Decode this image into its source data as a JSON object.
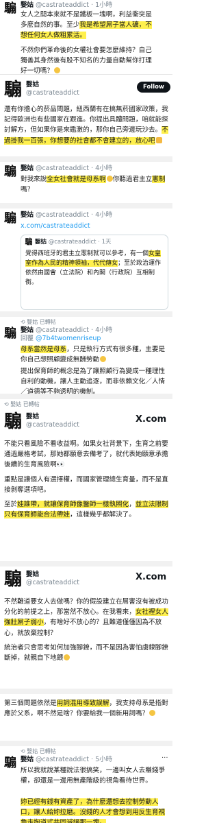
{
  "post1": {
    "text_lines": [
      "女人之間本來就不是鐵板一塊啊，利益衝突是",
      "多麼自然的事。至少我是希望屌子當人礦，不",
      "想任何女人做粗累活。",
      "不然你們革命後的女權社會要怎麼維持？自己",
      "獨善其身然後有股不知名的力量自動幫你打理",
      "好一切嗎？"
    ],
    "time_fragment": "小時",
    "hl": "我是希望屌子當人礦，不想任何女人做粗累活。"
  },
  "tweet2": {
    "name": "嫛姑",
    "handle": "@castrateaddict",
    "follow_label": "Follow",
    "avatar_char": "騸",
    "text_prefix": "還有你擔心的菸品問題，紐西蘭有在搞無菸國家政策，我記得歐洲也有些國家在跟進。你提出具體問題，咱就能探討解方，但如果你是來鑑激的，那你自己旁邊玩沙去。",
    "text_hl": "不過掛我一百張，你想要的社會都不會建立的，放心吧",
    "emoji_label": "👍"
  },
  "tweet3": {
    "name": "嫛姑",
    "handle": "@castrateaddict",
    "time": "4小時",
    "avatar_char": "騸",
    "text_a": "對我來說",
    "text_hl1": "全女社會就是母系啊",
    "text_b": "你聽過君主立",
    "text_hl2": "憲制",
    "text_c": "嗎？",
    "emoji_label": "🤔"
  },
  "tweet4": {
    "name": "嫛姑",
    "handle": "@castrateaddict",
    "time": "4小時",
    "avatar_char": "騸",
    "link": "x.com/castrateaddict",
    "quote": {
      "name": "嫛姑",
      "handle": "@castrateaddict",
      "time": "1天",
      "avatar_char": "騸",
      "text_a": "覺得西班牙的君主立憲制就可以參考，有一個",
      "text_hl": "女皇室作為人民的精神領袖，代代傳女",
      "text_b": "；至於政治運作依然由國會（立法院）和內閣（行政院）互相制衡。"
    }
  },
  "tweet5": {
    "retweet_label": "嫛姑 已轉帖",
    "name": "嫛姑",
    "handle": "@castrateaddict",
    "time": "4小時",
    "reply_to": "@7b4twomenriseup",
    "avatar_char": "騸",
    "text_hl": "母系當然是母系",
    "text_a": "，只是執行方式有很多種，主要是你自己想照顧變成無酬勞動",
    "text_p2": "提出保育師的概念是為了讓照顧行為變成一種理性自利的動機，讓人主動追逐，而非依賴文化／人情／道德等不夠透明的機制。",
    "emoji_label": "🤔"
  },
  "tweet6": {
    "retweet_label": "嫛姑 已轉帖",
    "name": "嫛姑",
    "handle": "@castrateaddict",
    "avatar_char": "騸",
    "brand": "X.com",
    "p1": "不能只看風險不看收益啊。如果女社背景下，生育之前要通過嚴格考試，那她都願意去備考了，就代表她願意承擔後續的生育風險啊",
    "p2": "重點是讓個人有選擇權，而國家管理總生育量，而不是直接剝奪選項吧。",
    "p3_a": "至於",
    "p3_hl1": "娃誰帶",
    "p3_b": "，就讓保育師像醫師一樣執照化",
    "p3_c": "，",
    "p3_hl2": "並立法限制只有保育師能合法帶娃",
    "p3_d": "，這樣幾乎都解決了。"
  },
  "tweet7": {
    "name": "嫛姑",
    "handle": "@castrateaddict",
    "avatar_char": "騸",
    "brand": "X.com",
    "p1_a": "不然難道要女人去做嗎？你的假設建立在屌害沒有被成功分化的前提之上，那當然不放心。在我看來，",
    "p1_hl": "女社裡女人強壯屌子弱小",
    "p1_b": "，有啥好不放心的？且難道僅僅因為不放心，就放棄控制？",
    "p2": "統治者只會思考如何加強腳鐐，而不是因為害怕虜隸腳鐐斷掉，就親自下地餵",
    "emoji_label": "😂"
  },
  "tweet8": {
    "p1_a": "第三個問題依然是",
    "p1_hl": "用詞混用導致誤解",
    "p1_b": "，我支持母系是指對應於父系，啊不然是啥？你要給我一個新用詞嗎？",
    "emoji_label": "🤔"
  },
  "tweet9": {
    "retweet_label": "嫛姑 已轉帖",
    "name": "嫛姑",
    "handle": "@castrateaddict",
    "time": "5小時",
    "avatar_char": "騸",
    "text": "所以我就說某種說法很搞笑，一邊叫女人去賺錢爭權，卻還是一邊用無產階級的視角看待世界。",
    "q_hl1": "妳已經有錢有資產了，為什麼還想去控制勞動人口",
    "q_hl2": "，讓人給妳拉磨。沒錢的人才會想到用反生育視角走掏道式共同滅絕那一塊。"
  }
}
